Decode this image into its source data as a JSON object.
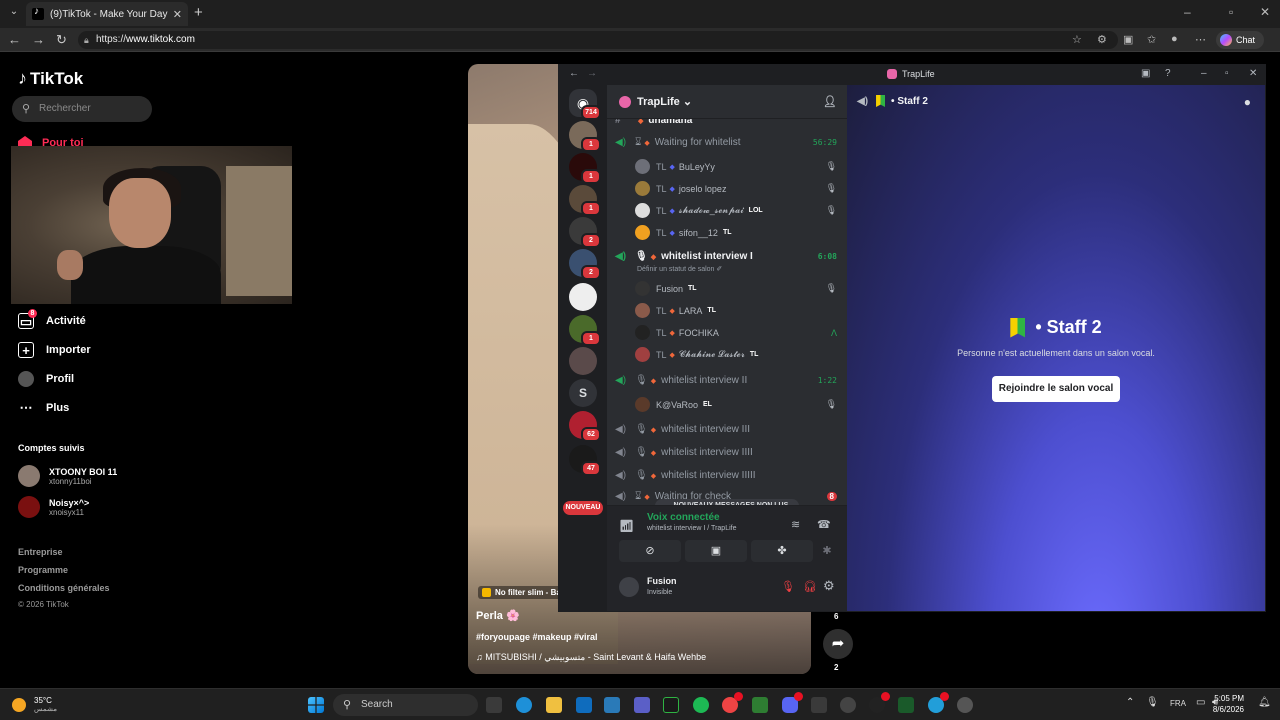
{
  "browser": {
    "tab_title": "(9)TikTok - Make Your Day",
    "url_prefix": "https://",
    "url_host": "www.tiktok.com",
    "chat_label": "Chat"
  },
  "tiktok": {
    "logo": "TikTok",
    "search_placeholder": "Rechercher",
    "nav": {
      "pour_toi": "Pour toi",
      "activite": "Activité",
      "activite_badge": "8",
      "importer": "Importer",
      "profil": "Profil",
      "plus": "Plus"
    },
    "followed_title": "Comptes suivis",
    "followed": [
      {
        "name": "XTOONY BOI 11",
        "handle": "xtonny11boi"
      },
      {
        "name": "Noisy×^>",
        "handle": "xnoisyx11"
      }
    ],
    "footer": [
      "Entreprise",
      "Programme",
      "Conditions générales"
    ],
    "copyright": "© 2026 TikTok",
    "video": {
      "chip": "No filter slim - Ba",
      "author": "Perla 🌸",
      "tags": "#foryoupage #makeup #viral",
      "music": "♫  MITSUBISHI / متسوبيشي - Saint Levant & Haifa Wehbe",
      "count_top": "6",
      "count_bottom": "2"
    }
  },
  "discord": {
    "window_title": "TrapLife",
    "server_name": "TrapLife",
    "guild_badges": [
      "714",
      "1",
      "1",
      "1",
      "2",
      "2",
      "1",
      "62",
      "47"
    ],
    "guild_letter": "S",
    "nouveau": "NOUVEAU",
    "channels": {
      "top_cut": "dhamana",
      "waiting": {
        "name": "Waiting for whitelist",
        "time": "56:29"
      },
      "waiting_users": [
        {
          "tl": "TL",
          "name": "BuLeyYy"
        },
        {
          "tl": "TL",
          "name": "joselo lopez"
        },
        {
          "tl": "TL",
          "name": "𝓼𝓱𝓪𝓭𝓸𝔀_𝓼𝓮𝓷𝓹𝓪𝓲",
          "tag": "LOL"
        },
        {
          "tl": "TL",
          "name": "sifon__12",
          "tag": "TL"
        }
      ],
      "interview1": {
        "name": "whitelist interview I",
        "time": "6:08",
        "status": "Définir un statut de salon ✐"
      },
      "interview1_users": [
        {
          "tl": "",
          "name": "Fusion",
          "tag": "TL"
        },
        {
          "tl": "TL",
          "name": "LARA",
          "tag": "TL"
        },
        {
          "tl": "TL",
          "name": "FOCHIKA"
        },
        {
          "tl": "TL",
          "name": "𝓒𝓱𝓪𝓱𝓲𝓷𝓮 𝓛𝓪𝓼𝓽𝓮𝓻",
          "tag": "TL"
        }
      ],
      "interview2": {
        "name": "whitelist interview II",
        "time": "1:22"
      },
      "interview2_users": [
        {
          "tl": "",
          "name": "K@VaRoo",
          "tag": "EL"
        }
      ],
      "interview3": "whitelist interview III",
      "interview4": "whitelist interview IIII",
      "interview5": "whitelist interview IIIII",
      "waiting_check": "Waiting for check",
      "waiting_check_badge": "8"
    },
    "new_messages": "NOUVEAUX MESSAGES NON LUS",
    "voice": {
      "title": "Voix connectée",
      "subtitle": "whitelist interview I / TrapLife"
    },
    "me": {
      "name": "Fusion",
      "status": "Invisible"
    },
    "main": {
      "channel": "Staff 2",
      "empty_text": "Personne n'est actuellement dans un salon vocal.",
      "join_button": "Rejoindre le salon vocal"
    }
  },
  "taskbar": {
    "temp": "35°C",
    "weather_sub": "مشمس",
    "search": "Search",
    "lang": "FRA",
    "time": "5:05 PM",
    "date": "8/6/2026"
  }
}
